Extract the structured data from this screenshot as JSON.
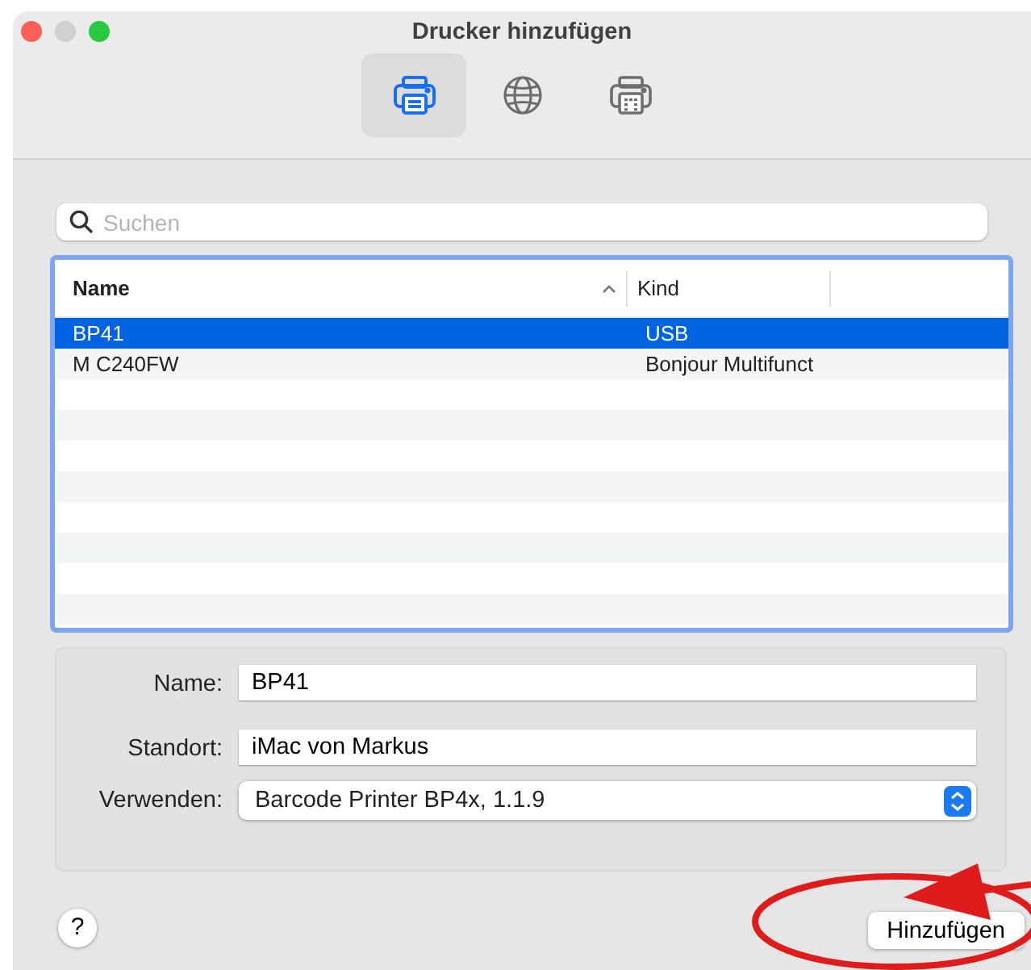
{
  "window": {
    "title": "Drucker hinzufügen"
  },
  "toolbar": {
    "tabs": [
      {
        "kind": "printer",
        "selected": true
      },
      {
        "kind": "globe",
        "selected": false
      },
      {
        "kind": "fax",
        "selected": false
      }
    ]
  },
  "search": {
    "placeholder": "Suchen"
  },
  "table": {
    "columns": [
      "Name",
      "Kind"
    ],
    "sort_ascending": true,
    "rows": [
      {
        "cells": [
          "BP41",
          "USB"
        ],
        "selected": true
      },
      {
        "cells": [
          "M C240FW",
          "Bonjour Multifunct"
        ],
        "selected": false
      }
    ]
  },
  "form": {
    "fields": [
      {
        "label": "Name:",
        "value": "BP41",
        "kind": "text"
      },
      {
        "label": "Standort:",
        "value": "iMac von Markus",
        "kind": "text"
      },
      {
        "label": "Verwenden:",
        "value": "Barcode Printer BP4x, 1.1.9",
        "kind": "popup"
      }
    ]
  },
  "buttons": {
    "help": "?",
    "add": "Hinzufügen"
  }
}
